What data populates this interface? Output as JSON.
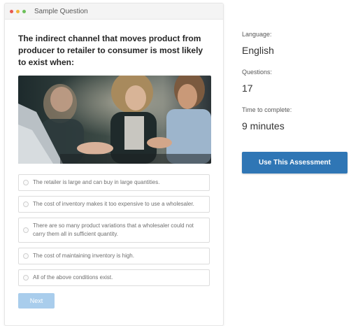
{
  "window": {
    "title": "Sample Question",
    "dot_colors": [
      "#e8584f",
      "#f2b53a",
      "#6cc05a"
    ]
  },
  "question": {
    "text": "The indirect channel that moves product from producer to retailer to consumer is most likely to exist when:",
    "image": "office-team-laptop-photo",
    "options": [
      "The retailer is large and can buy in large quantities.",
      "The cost of inventory makes it too expensive to use a wholesaler.",
      "There are so many product variations that a wholesaler could not carry them all in sufficient quantity.",
      "The cost of maintaining inventory is high.",
      "All of the above conditions exist."
    ],
    "next_label": "Next"
  },
  "details": {
    "language_label": "Language:",
    "language_value": "English",
    "questions_label": "Questions:",
    "questions_value": "17",
    "time_label": "Time to complete:",
    "time_value": "9 minutes",
    "cta_label": "Use This Assessment"
  },
  "colors": {
    "primary": "#2f76b5",
    "next_disabled": "#a9cdec"
  }
}
